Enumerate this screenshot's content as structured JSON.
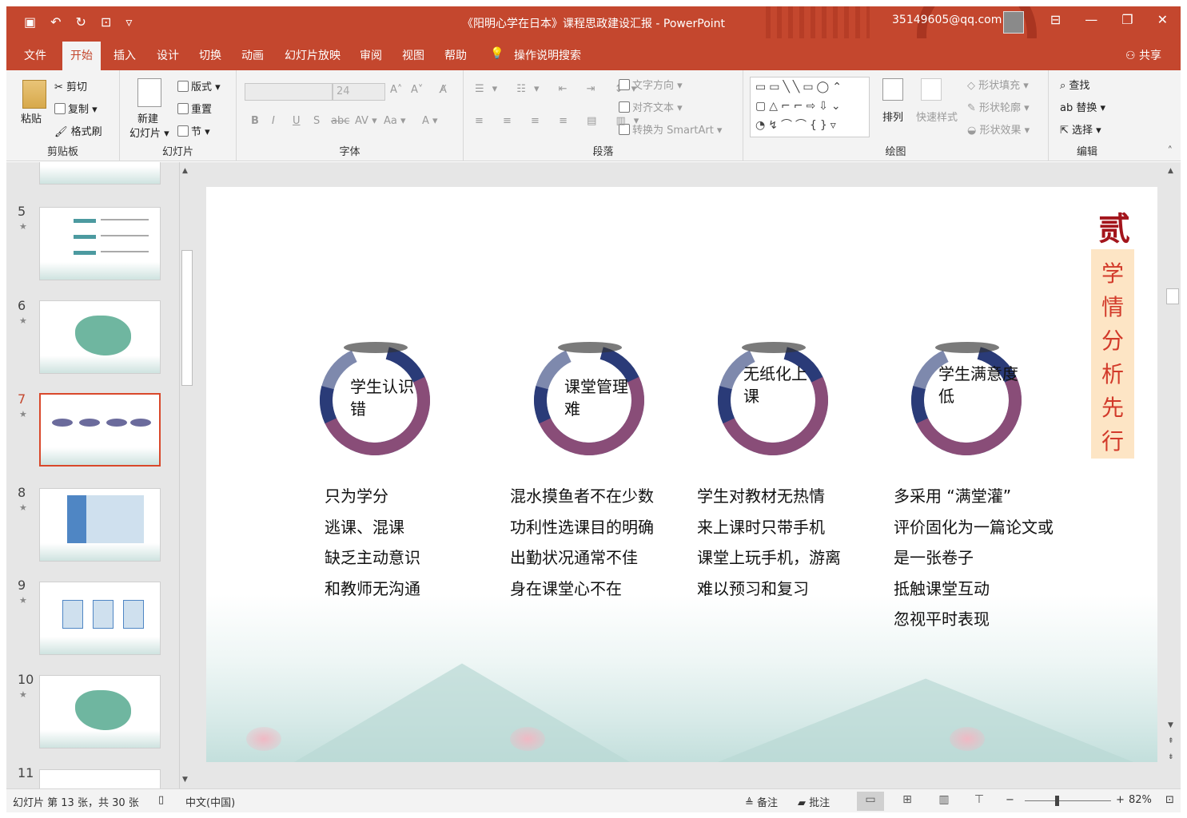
{
  "titlebar": {
    "title": "《阳明心学在日本》课程思政建设汇报  -  PowerPoint",
    "account": "35149605@qq.com",
    "quick_access": [
      "save-icon",
      "undo-icon",
      "redo-icon",
      "present-icon",
      "customize-icon"
    ]
  },
  "tabs": [
    "文件",
    "开始",
    "插入",
    "设计",
    "切换",
    "动画",
    "幻灯片放映",
    "审阅",
    "视图",
    "帮助"
  ],
  "active_tab": "开始",
  "tell_me": "操作说明搜索",
  "share": "共享",
  "ribbon": {
    "clipboard": {
      "paste": "粘贴",
      "cut": "剪切",
      "copy": "复制",
      "format_painter": "格式刷",
      "label": "剪贴板"
    },
    "slides": {
      "new_slide_1": "新建",
      "new_slide_2": "幻灯片",
      "layout": "版式",
      "reset": "重置",
      "section": "节",
      "label": "幻灯片"
    },
    "font": {
      "size": "24",
      "label": "字体",
      "bold": "B",
      "italic": "I",
      "underline": "U",
      "shadow": "S",
      "strike": "abc",
      "spacing": "AV",
      "case": "Aa",
      "color": "A",
      "grow": "A",
      "shrink": "A"
    },
    "paragraph": {
      "text_direction": "文字方向",
      "align_text": "对齐文本",
      "smartart": "转换为 SmartArt",
      "label": "段落"
    },
    "drawing": {
      "arrange": "排列",
      "quick_styles": "快速样式",
      "shape_fill": "形状填充",
      "shape_outline": "形状轮廓",
      "shape_effects": "形状效果",
      "label": "绘图"
    },
    "editing": {
      "find": "查找",
      "replace": "替换",
      "select": "选择",
      "label": "编辑"
    }
  },
  "thumbnails": [
    {
      "num": "5"
    },
    {
      "num": "6"
    },
    {
      "num": "7"
    },
    {
      "num": "8"
    },
    {
      "num": "9"
    },
    {
      "num": "10"
    },
    {
      "num": "11"
    }
  ],
  "slide": {
    "seal": "贰",
    "banner": [
      "学",
      "情",
      "分",
      "析",
      "先",
      "行"
    ],
    "circles": [
      {
        "title": "学生认识错",
        "lines": [
          "只为学分",
          "逃课、混课",
          "缺乏主动意识",
          "和教师无沟通"
        ]
      },
      {
        "title": "课堂管理难",
        "lines": [
          "混水摸鱼者不在少数",
          "功利性选课目的明确",
          "出勤状况通常不佳",
          "身在课堂心不在"
        ]
      },
      {
        "title": "无纸化上课",
        "lines": [
          "学生对教材无热情",
          "来上课时只带手机",
          "课堂上玩手机，游离",
          "难以预习和复习"
        ]
      },
      {
        "title": "学生满意度低",
        "lines": [
          "多采用 “满堂灌”",
          "评价固化为一篇论文或",
          "是一张卷子",
          "抵触课堂互动",
          "忽视平时表现"
        ]
      }
    ]
  },
  "statusbar": {
    "slide_info": "幻灯片 第 13 张，共 30 张",
    "language": "中文(中国)",
    "notes": "备注",
    "comments": "批注",
    "zoom": "82%"
  },
  "colors": {
    "accent": "#c4472e",
    "ring_blue": "#2a3b78",
    "banner_bg": "#fde5c5",
    "banner_text": "#d23a2a"
  }
}
